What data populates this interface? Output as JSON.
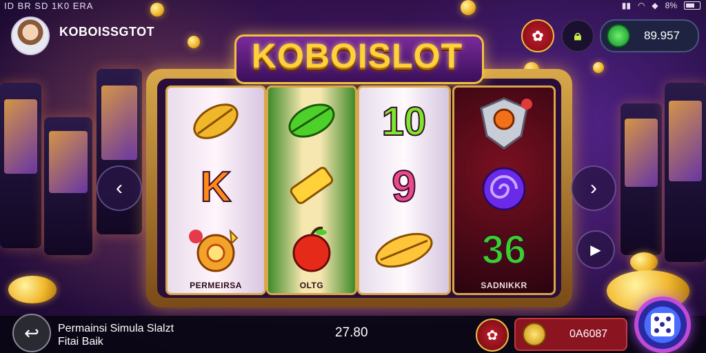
{
  "status_bar": {
    "left_text": "ID BR SD 1K0 ERA",
    "battery_text": "8%"
  },
  "header": {
    "brand_small": "KOBOISSGTOT",
    "balance": "89.957"
  },
  "logo": {
    "text": "KOBOISLOT"
  },
  "reels": [
    {
      "label": "PERMEIRSA",
      "symbols": [
        "golden-leaf-icon",
        "K",
        "flower-coin-icon"
      ]
    },
    {
      "label": "OLTG",
      "symbols": [
        "green-leaf-icon",
        "gold-bar-icon",
        "apple-icon"
      ]
    },
    {
      "label": "",
      "symbols": [
        "10",
        "9",
        "golden-leaf-icon"
      ]
    },
    {
      "label": "SADNIKKR",
      "symbols": [
        "shield-icon",
        "spiral-gem-icon",
        "36"
      ]
    }
  ],
  "bottom_bar": {
    "game_name_line1": "Permainsi Simula Slalzt",
    "game_name_line2": "Fitai Baik",
    "bet_value": "27.80",
    "win_value": "0A6087"
  },
  "colors": {
    "accent_gold": "#f0c040",
    "primary_purple": "#3a1456",
    "red_button": "#c21d2a"
  }
}
